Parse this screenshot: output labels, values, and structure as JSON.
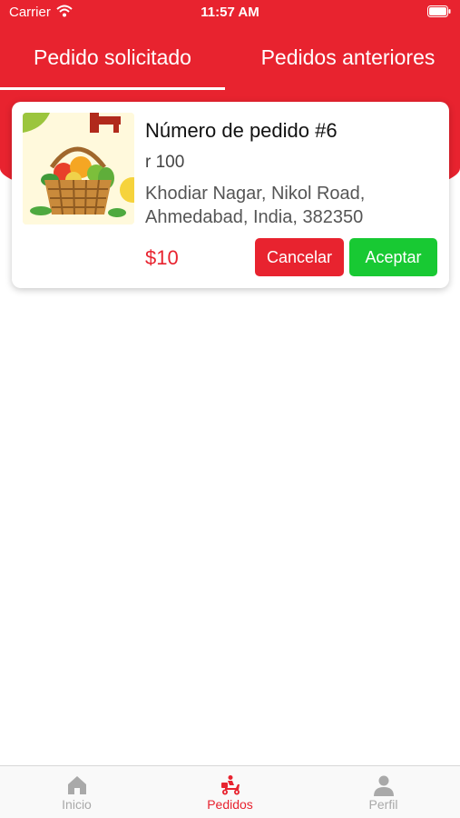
{
  "status_bar": {
    "carrier": "Carrier",
    "time": "11:57 AM"
  },
  "tabs": [
    {
      "label": "Pedido solicitado",
      "active": true
    },
    {
      "label": "Pedidos anteriores",
      "active": false
    }
  ],
  "order": {
    "title": "Número de pedido #6",
    "quantity": "r 100",
    "address": "Khodiar Nagar, Nikol Road, Ahmedabad, India, 382350",
    "price": "$10",
    "cancel_label": "Cancelar",
    "accept_label": "Aceptar",
    "image": "fruit-basket-image"
  },
  "bottom_nav": [
    {
      "label": "Inicio",
      "icon": "home-icon",
      "active": false
    },
    {
      "label": "Pedidos",
      "icon": "delivery-scooter-icon",
      "active": true
    },
    {
      "label": "Perfil",
      "icon": "person-icon",
      "active": false
    }
  ],
  "colors": {
    "primary_red": "#e8232f",
    "accept_green": "#18c933",
    "inactive_gray": "#a9a9a9"
  }
}
